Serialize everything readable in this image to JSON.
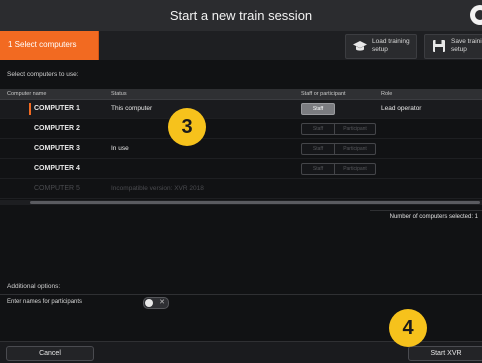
{
  "window": {
    "title": "Start a new train session"
  },
  "toolbar": {
    "step_label": "1  Select computers",
    "load_label": "Load training\nsetup",
    "save_label": "Save training\nsetup",
    "load_icon": "graduation-cap-icon",
    "save_icon": "floppy-disk-icon"
  },
  "computers": {
    "section_label": "Select computers to use:",
    "columns": [
      "Computer name",
      "Status",
      "Staff or participant",
      "Role"
    ],
    "rows": [
      {
        "name": "COMPUTER 1",
        "status": "This computer",
        "staff_label": "Staff",
        "role": "Lead operator",
        "selected": true,
        "disabled": false
      },
      {
        "name": "COMPUTER 2",
        "status": "",
        "staff_label": "Staff",
        "participant_label": "Participant",
        "role": "",
        "selected": false,
        "disabled": false
      },
      {
        "name": "COMPUTER 3",
        "status": "In use",
        "staff_label": "Staff",
        "participant_label": "Participant",
        "role": "",
        "selected": false,
        "disabled": false
      },
      {
        "name": "COMPUTER 4",
        "status": "",
        "staff_label": "Staff",
        "participant_label": "Participant",
        "role": "",
        "selected": false,
        "disabled": false
      },
      {
        "name": "COMPUTER 5",
        "status": "Incompatible version: XVR 2018",
        "role": "",
        "selected": false,
        "disabled": true
      }
    ],
    "count_text": "Number of computers selected:  1"
  },
  "options": {
    "section_label": "Additional options:",
    "names_label": "Enter names for participants",
    "names_enabled": false
  },
  "footer": {
    "cancel_label": "Cancel",
    "start_label": "Start XVR"
  },
  "callouts": {
    "step3": "3",
    "step4": "4"
  },
  "colors": {
    "accent": "#f26a21",
    "callout": "#f6c21c"
  }
}
